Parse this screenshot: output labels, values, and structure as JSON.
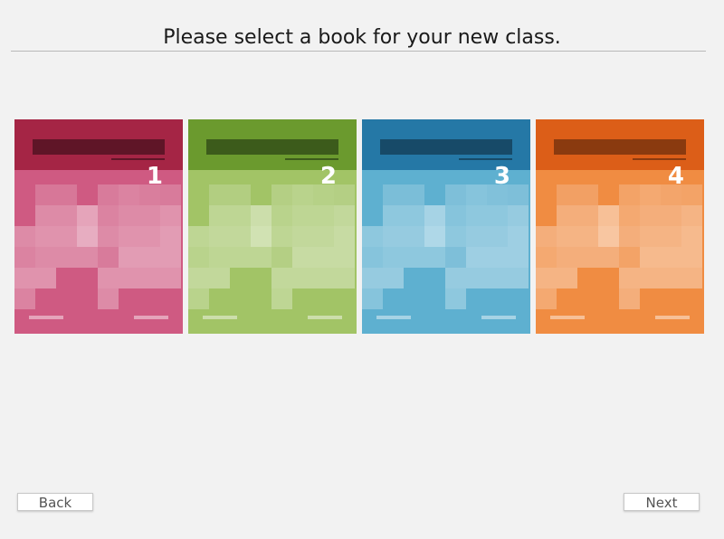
{
  "page": {
    "title": "Please select a book for your new class."
  },
  "books": [
    {
      "number": "1",
      "band_color": "#a52545",
      "bar_color": "#5f1527",
      "body_color": "#cf5a82"
    },
    {
      "number": "2",
      "band_color": "#6b9a2e",
      "bar_color": "#3c5b1b",
      "body_color": "#a2c466"
    },
    {
      "number": "3",
      "band_color": "#2578a6",
      "bar_color": "#174a68",
      "body_color": "#5eb0d0"
    },
    {
      "number": "4",
      "band_color": "#dc5e18",
      "bar_color": "#8a3a0f",
      "body_color": "#f08c42"
    }
  ],
  "buttons": {
    "back_label": "Back",
    "next_label": "Next"
  }
}
